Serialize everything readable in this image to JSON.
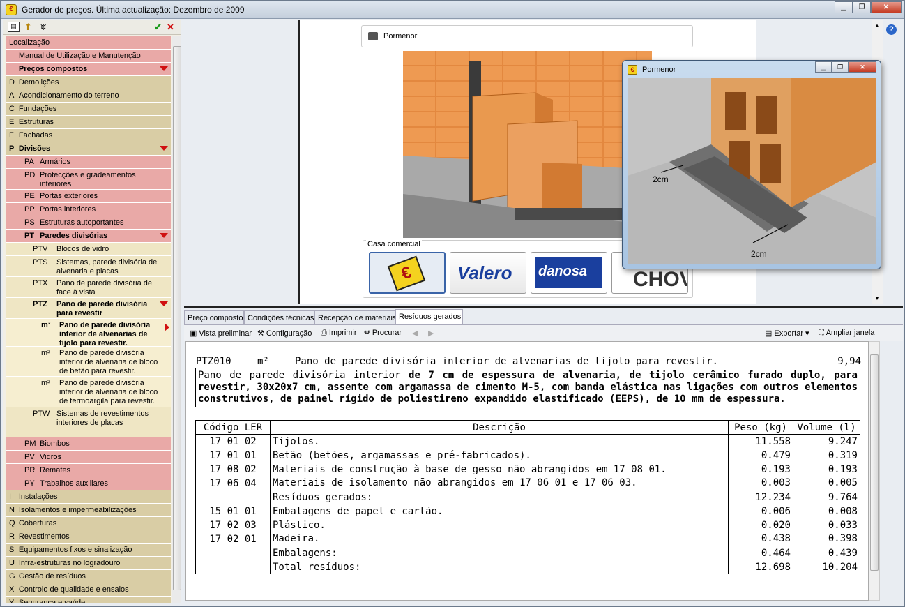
{
  "window": {
    "title": "Gerador de preços. Última actualização: Dezembro de 2009",
    "min": "▁",
    "max": "❐",
    "close": "✕"
  },
  "left_toolbar": {
    "icons": [
      "list-icon",
      "up-icon",
      "binoculars-icon",
      "check-icon",
      "cross-icon"
    ]
  },
  "tree": [
    {
      "code": "",
      "label": "Localização",
      "level": 0
    },
    {
      "code": "",
      "label": "Manual de Utilização e Manutenção",
      "level": 0
    },
    {
      "code": "",
      "label": "Preços compostos",
      "level": 0,
      "bold": true,
      "exp": true
    },
    {
      "code": "D",
      "label": "Demolições",
      "level": 1
    },
    {
      "code": "A",
      "label": "Acondicionamento do terreno",
      "level": 1
    },
    {
      "code": "C",
      "label": "Fundações",
      "level": 1
    },
    {
      "code": "E",
      "label": "Estruturas",
      "level": 1
    },
    {
      "code": "F",
      "label": "Fachadas",
      "level": 1
    },
    {
      "code": "P",
      "label": "Divisões",
      "level": 1,
      "bold": true,
      "exp": true
    },
    {
      "code": "PA",
      "label": "Armários",
      "level": 2
    },
    {
      "code": "PD",
      "label": "Protecções e gradeamentos interiores",
      "level": 2
    },
    {
      "code": "PE",
      "label": "Portas exteriores",
      "level": 2
    },
    {
      "code": "PP",
      "label": "Portas interiores",
      "level": 2
    },
    {
      "code": "PS",
      "label": "Estruturas autoportantes",
      "level": 2
    },
    {
      "code": "PT",
      "label": "Paredes divisórias",
      "level": 2,
      "bold": true,
      "exp": true
    },
    {
      "code": "PTV",
      "label": "Blocos de vidro",
      "level": 3
    },
    {
      "code": "PTS",
      "label": "Sistemas, parede divisória de alvenaria e placas",
      "level": 3
    },
    {
      "code": "PTX",
      "label": "Pano de parede divisória de face à vista",
      "level": 3
    },
    {
      "code": "PTZ",
      "label": "Pano de parede divisória para revestir",
      "level": 3,
      "bold": true,
      "exp": true
    },
    {
      "code": "m²",
      "label": "Pano de parede divisória interior de alvenarias de tijolo para revestir.",
      "level": 4,
      "bold": true,
      "sel": true
    },
    {
      "code": "m²",
      "label": "Pano de parede divisória interior de alvenaria de bloco de betão para revestir.",
      "level": 4
    },
    {
      "code": "m²",
      "label": "Pano de parede divisória interior de alvenaria de bloco de termoargila para revestir.",
      "level": 4
    },
    {
      "code": "PTW",
      "label": "Sistemas de revestimentos interiores de placas",
      "level": 3
    },
    {
      "code": "PM",
      "label": "Biombos",
      "level": 2
    },
    {
      "code": "PV",
      "label": "Vidros",
      "level": 2
    },
    {
      "code": "PR",
      "label": "Remates",
      "level": 2
    },
    {
      "code": "PY",
      "label": "Trabalhos auxiliares",
      "level": 2
    },
    {
      "code": "I",
      "label": "Instalações",
      "level": 1
    },
    {
      "code": "N",
      "label": "Isolamentos e impermeabilizações",
      "level": 1
    },
    {
      "code": "Q",
      "label": "Coberturas",
      "level": 1
    },
    {
      "code": "R",
      "label": "Revestimentos",
      "level": 1
    },
    {
      "code": "S",
      "label": "Equipamentos fixos e sinalização",
      "level": 1
    },
    {
      "code": "U",
      "label": "Infra-estruturas no logradouro",
      "level": 1
    },
    {
      "code": "G",
      "label": "Gestão de resíduos",
      "level": 1
    },
    {
      "code": "X",
      "label": "Controlo de qualidade e ensaios",
      "level": 1
    },
    {
      "code": "Y",
      "label": "Segurança e saúde",
      "level": 1
    }
  ],
  "detail": {
    "title": "Pormenor"
  },
  "casa": {
    "label": "Casa comercial",
    "brands": [
      "€",
      "Valero",
      "danosa",
      "CHOVA"
    ]
  },
  "popup": {
    "title": "Pormenor",
    "dim1": "2cm",
    "dim2": "2cm"
  },
  "tabs": [
    "Preço composto",
    "Condições técnicas",
    "Recepção de materiais",
    "Resíduos gerados"
  ],
  "active_tab": 3,
  "toolbar": {
    "vista": "Vista preliminar",
    "config": "Configuração",
    "imprimir": "Imprimir",
    "procurar": "Procurar",
    "exportar": "Exportar",
    "ampliar": "Ampliar janela"
  },
  "doc": {
    "code": "PTZ010",
    "unit": "m²",
    "short": "Pano de parede divisória interior de alvenarias de tijolo para revestir.",
    "price": "9,94",
    "long_plain": "Pano de parede divisória interior ",
    "long_bold": "de 7 cm de espessura de alvenaria, de tijolo cerâmico furado duplo, para revestir, 30x20x7 cm, assente com argamassa de cimento M-5, com banda elástica nas ligações com outros elementos construtivos, de painel rígido de poliestireno expandido elastificado (EEPS), de 10 mm de espessura",
    "long_end": ".",
    "headers": [
      "Código LER",
      "Descrição",
      "Peso (kg)",
      "Volume (l)"
    ],
    "rows": [
      {
        "c": "17 01 02",
        "d": "Tijolos.",
        "p": "11.558",
        "v": "9.247"
      },
      {
        "c": "17 01 01",
        "d": "Betão (betões, argamassas e pré-fabricados).",
        "p": "0.479",
        "v": "0.319"
      },
      {
        "c": "17 08 02",
        "d": "Materiais de construção à base de gesso não abrangidos em 17 08 01.",
        "p": "0.193",
        "v": "0.193"
      },
      {
        "c": "17 06 04",
        "d": "Materiais de isolamento não abrangidos em 17 06 01 e 17 06 03.",
        "p": "0.003",
        "v": "0.005"
      },
      {
        "c": "",
        "d": "Resíduos gerados:",
        "p": "12.234",
        "v": "9.764",
        "sub": true
      },
      {
        "c": "15 01 01",
        "d": "Embalagens de papel e cartão.",
        "p": "0.006",
        "v": "0.008"
      },
      {
        "c": "17 02 03",
        "d": "Plástico.",
        "p": "0.020",
        "v": "0.033"
      },
      {
        "c": "17 02 01",
        "d": "Madeira.",
        "p": "0.438",
        "v": "0.398"
      },
      {
        "c": "",
        "d": "Embalagens:",
        "p": "0.464",
        "v": "0.439",
        "sub": true
      },
      {
        "c": "",
        "d": "Total resíduos:",
        "p": "12.698",
        "v": "10.204",
        "sub": true,
        "last": true
      }
    ]
  }
}
